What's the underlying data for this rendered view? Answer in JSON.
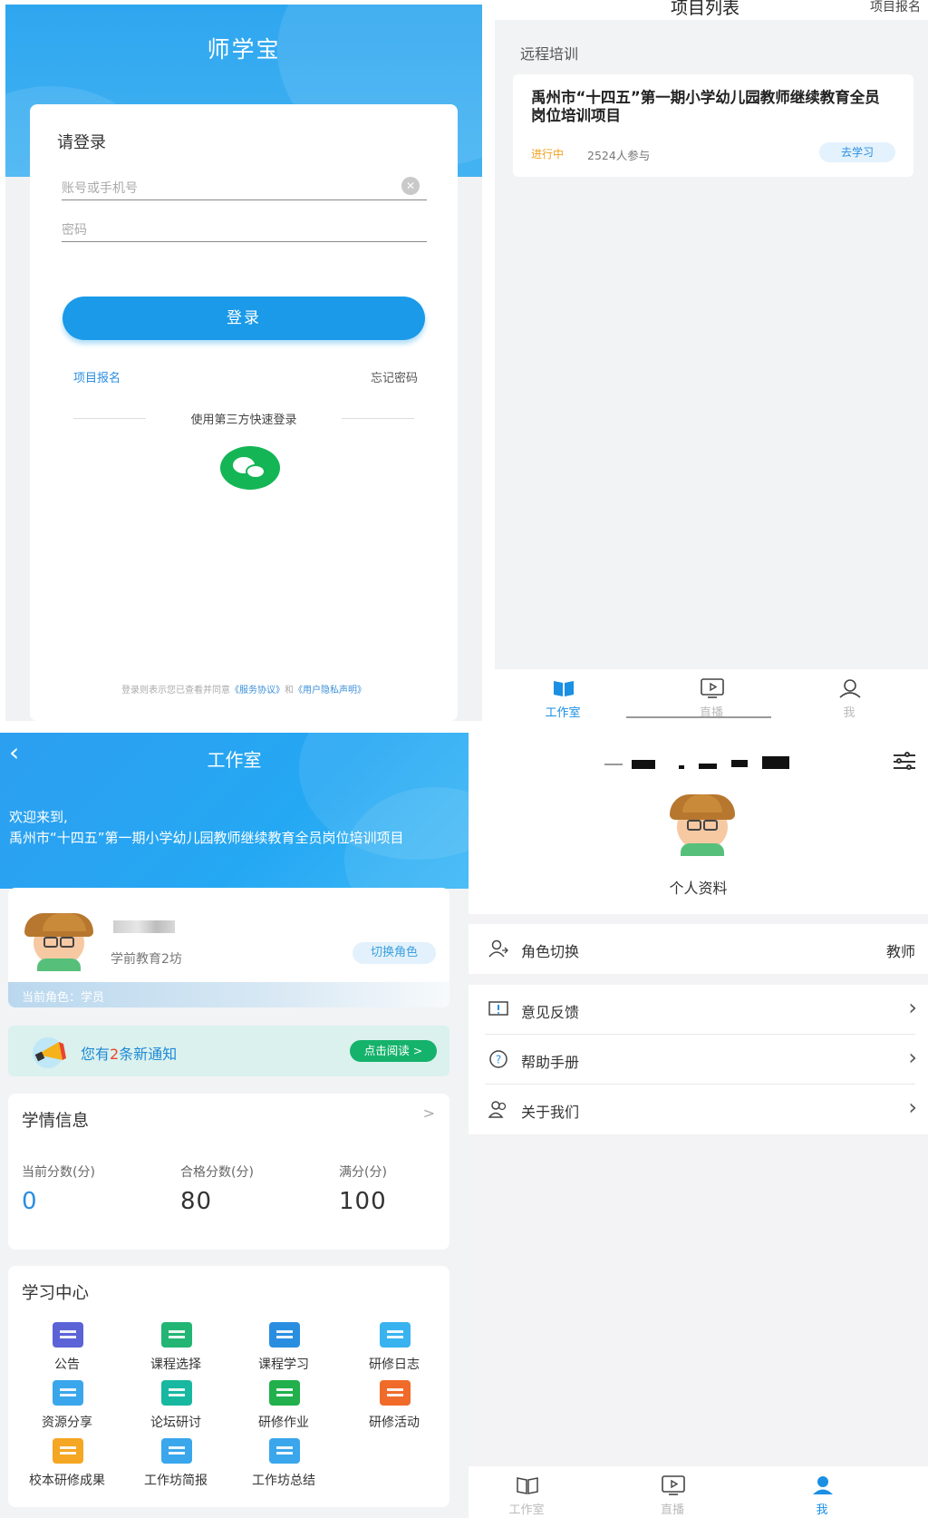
{
  "login": {
    "app_title": "师学宝",
    "heading": "请登录",
    "account_placeholder": "账号或手机号",
    "password_placeholder": "密码",
    "login_button": "登录",
    "signup_link": "项目报名",
    "forgot_link": "忘记密码",
    "third_party": "使用第三方快速登录",
    "agreement_prefix": "登录则表示您已查看并同意",
    "service_agreement": "《服务协议》",
    "agreement_and": "和",
    "privacy_statement": "《用户隐私声明》"
  },
  "project_list": {
    "title": "项目列表",
    "signup": "项目报名",
    "section": "远程培训",
    "project": {
      "name": "禹州市“十四五”第一期小学幼儿园教师继续教育全员岗位培训项目",
      "status": "进行中",
      "participants": "2524人参与",
      "action": "去学习"
    },
    "tabs": [
      {
        "label": "工作室",
        "active": true
      },
      {
        "label": "直播",
        "active": false
      },
      {
        "label": "我",
        "active": false
      }
    ]
  },
  "workspace": {
    "title": "工作室",
    "welcome": "欢迎来到,",
    "project_name": "禹州市“十四五”第一期小学幼儿园教师继续教育全员岗位培训项目",
    "workshop": "学前教育2坊",
    "switch_role": "切换角色",
    "current_role": "当前角色：学员",
    "notice_prefix": "您有",
    "notice_count": "2",
    "notice_suffix": "条新通知",
    "read_button": "点击阅读 >",
    "info_title": "学情信息",
    "chevron": ">",
    "scores": [
      {
        "label": "当前分数(分)",
        "value": "0"
      },
      {
        "label": "合格分数(分)",
        "value": "80"
      },
      {
        "label": "满分(分)",
        "value": "100"
      }
    ],
    "center_title": "学习中心",
    "center_items": [
      {
        "label": "公告",
        "icon": "announcement-icon",
        "color": "#5b63d6"
      },
      {
        "label": "课程选择",
        "icon": "course-select-icon",
        "color": "#22b573"
      },
      {
        "label": "课程学习",
        "icon": "book-icon",
        "color": "#2a8ee0"
      },
      {
        "label": "研修日志",
        "icon": "log-icon",
        "color": "#39b3f0"
      },
      {
        "label": "资源分享",
        "icon": "resource-icon",
        "color": "#3aa6ec"
      },
      {
        "label": "论坛研讨",
        "icon": "forum-icon",
        "color": "#18b8a0"
      },
      {
        "label": "研修作业",
        "icon": "homework-icon",
        "color": "#21b04b"
      },
      {
        "label": "研修活动",
        "icon": "activity-icon",
        "color": "#f06b2a"
      },
      {
        "label": "校本研修成果",
        "icon": "trophy-icon",
        "color": "#f5a623"
      },
      {
        "label": "工作坊简报",
        "icon": "brief-icon",
        "color": "#3aa6ec"
      },
      {
        "label": "工作坊总结",
        "icon": "summary-icon",
        "color": "#3aa6ec"
      }
    ]
  },
  "me": {
    "profile_label": "个人资料",
    "menu": [
      {
        "label": "角色切换",
        "value": "教师",
        "icon": "role-icon"
      },
      {
        "label": "意见反馈",
        "value": "",
        "icon": "feedback-icon"
      },
      {
        "label": "帮助手册",
        "value": "",
        "icon": "help-icon"
      },
      {
        "label": "关于我们",
        "value": "",
        "icon": "about-icon"
      }
    ],
    "tabs": [
      {
        "label": "工作室",
        "active": false
      },
      {
        "label": "直播",
        "active": false
      },
      {
        "label": "我",
        "active": true
      }
    ]
  },
  "colors": {
    "brand_blue": "#1a9ae8",
    "wechat_green": "#14b555",
    "notice_red": "#e8452c",
    "status_orange": "#f0a020"
  }
}
